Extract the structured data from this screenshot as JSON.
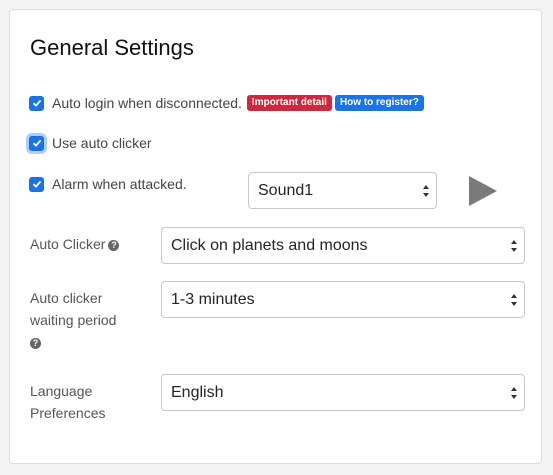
{
  "title": "General Settings",
  "checkboxes": {
    "auto_login": {
      "label": "Auto login when disconnected.",
      "checked": true
    },
    "auto_clicker": {
      "label": "Use auto clicker",
      "checked": true
    },
    "alarm": {
      "label": "Alarm when attacked.",
      "checked": true
    }
  },
  "badges": {
    "important": {
      "label": "Important detail",
      "color": "#d1263b"
    },
    "register": {
      "label": "How to register?",
      "color": "#1a73e8"
    }
  },
  "sound_select": {
    "value": "Sound1"
  },
  "play_icon": "play-icon",
  "fields": {
    "auto_clicker": {
      "label": "Auto Clicker",
      "value": "Click on planets and moons",
      "help_icon": "question-circle-icon"
    },
    "waiting_period": {
      "label_line1": "Auto clicker",
      "label_line2": "waiting period",
      "value": "1-3 minutes",
      "help_icon": "question-circle-icon"
    },
    "language": {
      "label_line1": "Language",
      "label_line2": "Preferences",
      "value": "English"
    }
  },
  "colors": {
    "accent": "#1a73e8",
    "danger": "#d1263b",
    "play": "#7a7a7a"
  }
}
